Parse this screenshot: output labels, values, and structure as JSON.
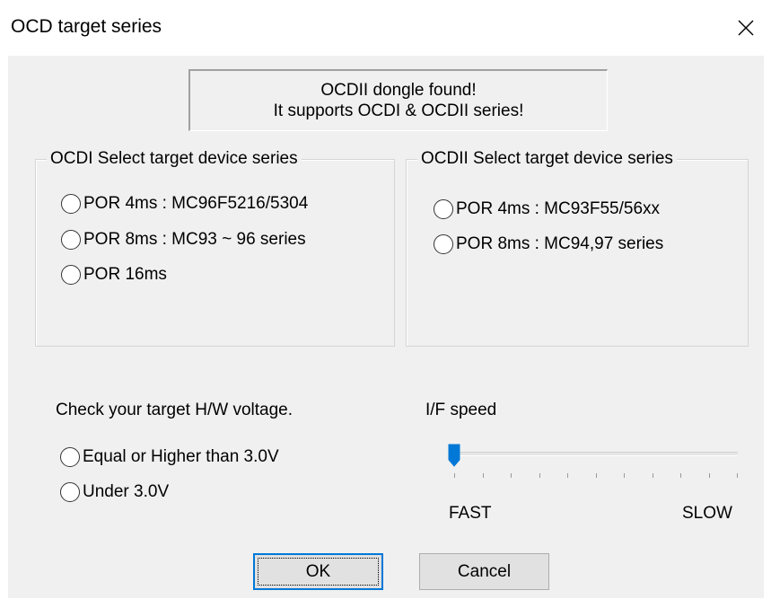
{
  "window": {
    "title": "OCD target series",
    "close_icon": "close-icon"
  },
  "banner": {
    "line1": "OCDII dongle found!",
    "line2": "It supports OCDI & OCDII series!"
  },
  "ocdi_group": {
    "legend": "OCDI Select target device series",
    "options": [
      {
        "label": "POR 4ms : MC96F5216/5304",
        "selected": false
      },
      {
        "label": "POR 8ms : MC93 ~ 96 series",
        "selected": false
      },
      {
        "label": "POR 16ms",
        "selected": false
      }
    ]
  },
  "ocdii_group": {
    "legend": "OCDII Select target device series",
    "options": [
      {
        "label": "POR 4ms : MC93F55/56xx",
        "selected": false
      },
      {
        "label": "POR 8ms : MC94,97 series",
        "selected": false
      }
    ]
  },
  "voltage": {
    "label": "Check your target H/W voltage.",
    "options": [
      {
        "label": "Equal or Higher than 3.0V",
        "selected": false
      },
      {
        "label": "Under 3.0V",
        "selected": false
      }
    ]
  },
  "speed": {
    "label": "I/F speed",
    "min_label": "FAST",
    "max_label": "SLOW",
    "value": 0,
    "tick_count": 11,
    "thumb_color": "#0078d7"
  },
  "buttons": {
    "ok": "OK",
    "cancel": "Cancel"
  }
}
